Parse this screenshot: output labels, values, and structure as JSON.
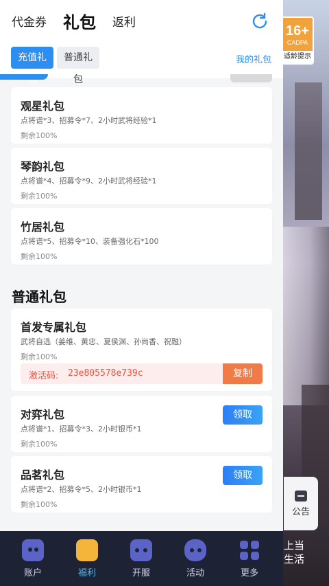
{
  "top_tabs": [
    {
      "label": "代金券"
    },
    {
      "label": "礼包"
    },
    {
      "label": "返利"
    }
  ],
  "sub_tabs": {
    "recharge": "充值礼包",
    "normal": "普通礼包",
    "my_gift": "我的礼包"
  },
  "recharge_gifts": [
    {
      "title": "观星礼包",
      "desc": "点将谱*3、招募令*7、2小时武将经验*1",
      "remain": "剩余100%"
    },
    {
      "title": "琴韵礼包",
      "desc": "点将谱*4、招募令*9、2小时武将经验*1",
      "remain": "剩余100%"
    },
    {
      "title": "竹居礼包",
      "desc": "点将谱*5、招募令*10、装备强化石*100",
      "remain": "剩余100%"
    }
  ],
  "normal_section_title": "普通礼包",
  "first_gift": {
    "title": "首发专属礼包",
    "desc": "武将自选（姜维、黄忠、夏侯渊、孙尚香、祝融）",
    "remain": "剩余100%",
    "code_label": "激活码:",
    "code": "23e805578e739c",
    "copy_label": "复制"
  },
  "normal_gifts": [
    {
      "title": "对弈礼包",
      "desc": "点将谱*1、招募令*3、2小时银币*1",
      "remain": "剩余100%",
      "button": "领取"
    },
    {
      "title": "品茗礼包",
      "desc": "点将谱*2、招募令*5、2小时银币*1",
      "remain": "剩余100%",
      "button": "领取"
    }
  ],
  "bottom_nav": [
    {
      "label": "账户",
      "icon": "account-icon"
    },
    {
      "label": "福利",
      "icon": "gift-icon"
    },
    {
      "label": "开服",
      "icon": "gamepad-icon"
    },
    {
      "label": "活动",
      "icon": "controller-icon"
    },
    {
      "label": "更多",
      "icon": "grid-icon"
    }
  ],
  "age_badge": {
    "rating": "16+",
    "org": "CADPA",
    "hint": "适龄提示"
  },
  "notice": {
    "label": "公告"
  },
  "background_text": "上当\n生活",
  "colors": {
    "accent": "#2b8ef0",
    "copy": "#f07b46",
    "code": "#f0503c",
    "nav_bg": "#1e2235"
  }
}
